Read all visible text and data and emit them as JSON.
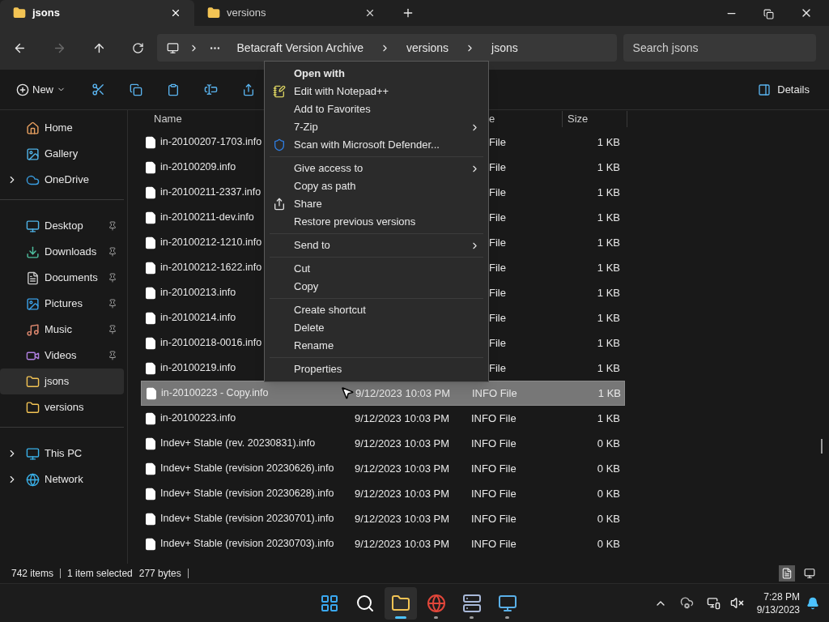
{
  "tabs": [
    {
      "label": "jsons",
      "selected": true
    },
    {
      "label": "versions",
      "selected": false
    }
  ],
  "breadcrumb": [
    "Betacraft Version Archive",
    "versions",
    "jsons"
  ],
  "search": {
    "placeholder": "Search jsons"
  },
  "toolbar": {
    "new_label": "New",
    "details_label": "Details"
  },
  "sidebar": [
    [
      {
        "label": "Home",
        "kind": "home",
        "expandable": false,
        "pinned": false,
        "selected": false
      },
      {
        "label": "Gallery",
        "kind": "gallery",
        "expandable": false,
        "pinned": false,
        "selected": false
      },
      {
        "label": "OneDrive",
        "kind": "cloud",
        "expandable": true,
        "pinned": false,
        "selected": false
      }
    ],
    [
      {
        "label": "Desktop",
        "kind": "desktop",
        "expandable": false,
        "pinned": true,
        "selected": false
      },
      {
        "label": "Downloads",
        "kind": "downloads",
        "expandable": false,
        "pinned": true,
        "selected": false
      },
      {
        "label": "Documents",
        "kind": "documents",
        "expandable": false,
        "pinned": true,
        "selected": false
      },
      {
        "label": "Pictures",
        "kind": "pictures",
        "expandable": false,
        "pinned": true,
        "selected": false
      },
      {
        "label": "Music",
        "kind": "music",
        "expandable": false,
        "pinned": true,
        "selected": false
      },
      {
        "label": "Videos",
        "kind": "videos",
        "expandable": false,
        "pinned": true,
        "selected": false
      },
      {
        "label": "jsons",
        "kind": "folder",
        "expandable": false,
        "pinned": false,
        "selected": true
      },
      {
        "label": "versions",
        "kind": "folder",
        "expandable": false,
        "pinned": false,
        "selected": false
      }
    ],
    [
      {
        "label": "This PC",
        "kind": "pc",
        "expandable": true,
        "pinned": false,
        "selected": false
      },
      {
        "label": "Network",
        "kind": "network",
        "expandable": true,
        "pinned": false,
        "selected": false
      }
    ]
  ],
  "table": {
    "columns": [
      "Name",
      "e",
      "Size"
    ],
    "rows": [
      {
        "name": "in-20100207-1703.info",
        "type": "File",
        "size": "1 KB",
        "selected": false
      },
      {
        "name": "in-20100209.info",
        "type": "File",
        "size": "1 KB",
        "selected": false
      },
      {
        "name": "in-20100211-2337.info",
        "type": "File",
        "size": "1 KB",
        "selected": false
      },
      {
        "name": "in-20100211-dev.info",
        "type": "File",
        "size": "1 KB",
        "selected": false
      },
      {
        "name": "in-20100212-1210.info",
        "type": "File",
        "size": "1 KB",
        "selected": false
      },
      {
        "name": "in-20100212-1622.info",
        "type": "File",
        "size": "1 KB",
        "selected": false
      },
      {
        "name": "in-20100213.info",
        "type": "File",
        "size": "1 KB",
        "selected": false
      },
      {
        "name": "in-20100214.info",
        "type": "File",
        "size": "1 KB",
        "selected": false
      },
      {
        "name": "in-20100218-0016.info",
        "type": "File",
        "size": "1 KB",
        "selected": false
      },
      {
        "name": "in-20100219.info",
        "type": "File",
        "size": "1 KB",
        "selected": false
      },
      {
        "name": "in-20100223 - Copy.info",
        "date": "9/12/2023 10:03 PM",
        "type": "INFO File",
        "size": "1 KB",
        "selected": true
      },
      {
        "name": "in-20100223.info",
        "date": "9/12/2023 10:03 PM",
        "type": "INFO File",
        "size": "1 KB",
        "selected": false
      },
      {
        "name": "Indev+ Stable (rev. 20230831).info",
        "date": "9/12/2023 10:03 PM",
        "type": "INFO File",
        "size": "0 KB",
        "selected": false
      },
      {
        "name": "Indev+ Stable (revision 20230626).info",
        "date": "9/12/2023 10:03 PM",
        "type": "INFO File",
        "size": "0 KB",
        "selected": false
      },
      {
        "name": "Indev+ Stable (revision 20230628).info",
        "date": "9/12/2023 10:03 PM",
        "type": "INFO File",
        "size": "0 KB",
        "selected": false
      },
      {
        "name": "Indev+ Stable (revision 20230701).info",
        "date": "9/12/2023 10:03 PM",
        "type": "INFO File",
        "size": "0 KB",
        "selected": false
      },
      {
        "name": "Indev+ Stable (revision 20230703).info",
        "date": "9/12/2023 10:03 PM",
        "type": "INFO File",
        "size": "0 KB",
        "selected": false
      }
    ]
  },
  "context_menu": [
    [
      {
        "label": "Open with",
        "default": true,
        "kind": "none",
        "submenu": false
      },
      {
        "label": "Edit with Notepad++",
        "default": false,
        "kind": "notepad",
        "submenu": false
      },
      {
        "label": "Add to Favorites",
        "default": false,
        "kind": "none",
        "submenu": false
      },
      {
        "label": "7-Zip",
        "default": false,
        "kind": "none",
        "submenu": true
      },
      {
        "label": "Scan with Microsoft Defender...",
        "default": false,
        "kind": "shield",
        "submenu": false
      }
    ],
    [
      {
        "label": "Give access to",
        "default": false,
        "kind": "none",
        "submenu": true
      },
      {
        "label": "Copy as path",
        "default": false,
        "kind": "none",
        "submenu": false
      },
      {
        "label": "Share",
        "default": false,
        "kind": "share",
        "submenu": false
      },
      {
        "label": "Restore previous versions",
        "default": false,
        "kind": "none",
        "submenu": false
      }
    ],
    [
      {
        "label": "Send to",
        "default": false,
        "kind": "none",
        "submenu": true
      }
    ],
    [
      {
        "label": "Cut",
        "default": false,
        "kind": "none",
        "submenu": false
      },
      {
        "label": "Copy",
        "default": false,
        "kind": "none",
        "submenu": false
      }
    ],
    [
      {
        "label": "Create shortcut",
        "default": false,
        "kind": "none",
        "submenu": false
      },
      {
        "label": "Delete",
        "default": false,
        "kind": "none",
        "submenu": false
      },
      {
        "label": "Rename",
        "default": false,
        "kind": "none",
        "submenu": false
      }
    ],
    [
      {
        "label": "Properties",
        "default": false,
        "kind": "none",
        "submenu": false
      }
    ]
  ],
  "status_bar": {
    "count": "742 items",
    "selection": "1 item selected",
    "bytes": "277 bytes"
  },
  "taskbar": {
    "apps": [
      {
        "kind": "start",
        "running": false,
        "active": false
      },
      {
        "kind": "search",
        "running": false,
        "active": false
      },
      {
        "kind": "explorer",
        "running": true,
        "active": true
      },
      {
        "kind": "browser",
        "running": true,
        "active": false
      },
      {
        "kind": "network-tool",
        "running": true,
        "active": false
      },
      {
        "kind": "control-panel",
        "running": true,
        "active": false
      }
    ],
    "time": "7:28 PM",
    "date": "9/13/2023"
  }
}
